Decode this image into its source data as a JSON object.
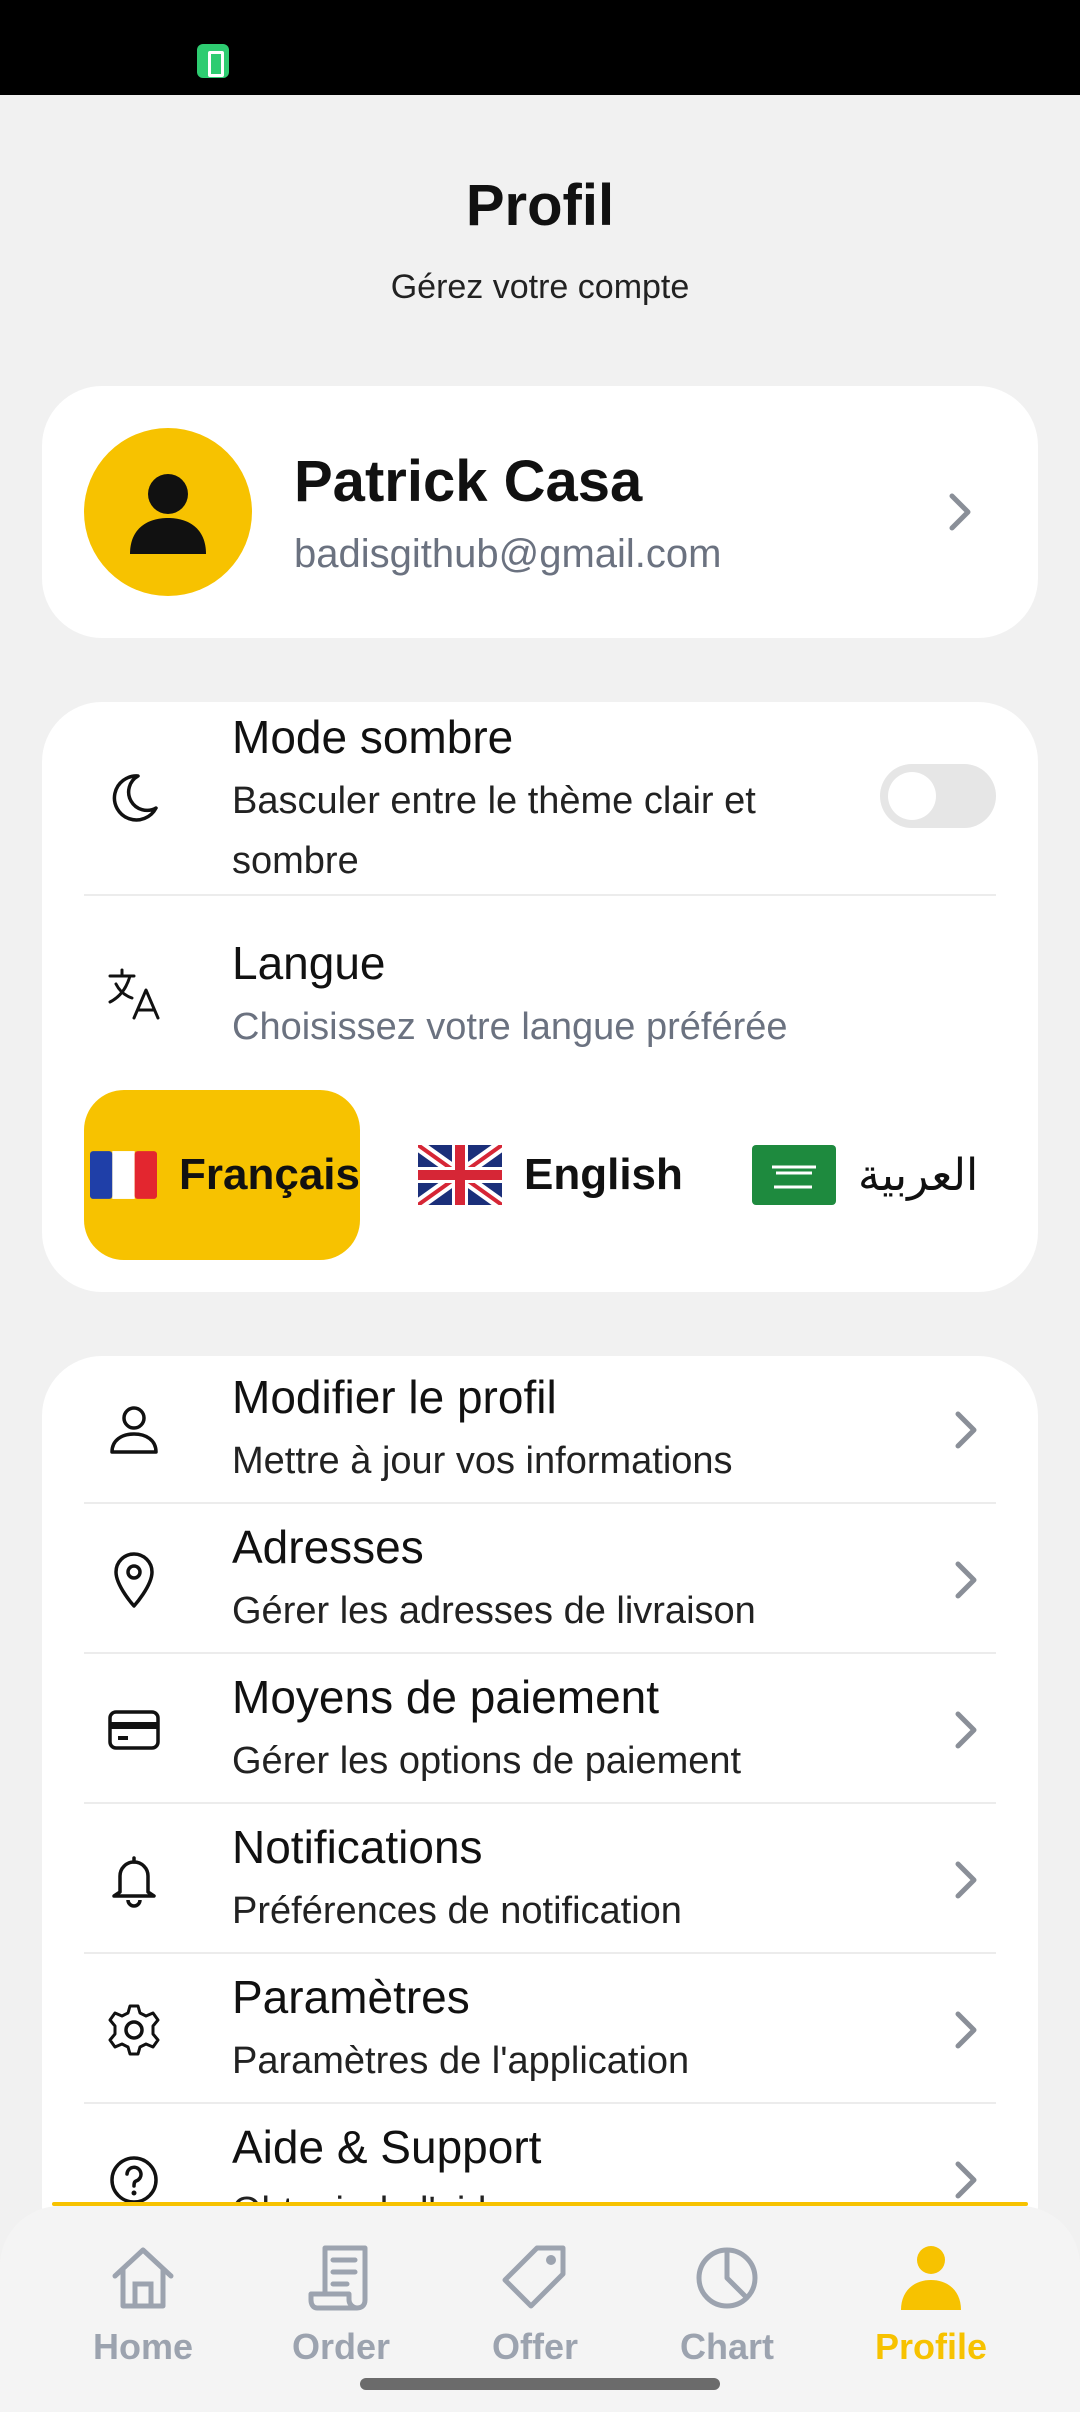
{
  "header": {
    "title": "Profil",
    "subtitle": "Gérez votre compte"
  },
  "profile": {
    "name": "Patrick Casa",
    "email": "badisgithub@gmail.com"
  },
  "settings": {
    "dark_mode": {
      "title": "Mode sombre",
      "subtitle_line1": "Basculer entre le thème clair et",
      "subtitle_line2": "sombre",
      "enabled": false
    },
    "language": {
      "title": "Langue",
      "subtitle": "Choisissez votre langue préférée"
    },
    "languages": [
      {
        "label": "Français",
        "active": true
      },
      {
        "label": "English",
        "active": false
      },
      {
        "label": "العربية",
        "active": false
      }
    ]
  },
  "menu": [
    {
      "title": "Modifier le profil",
      "subtitle": "Mettre à jour vos informations",
      "icon": "user-icon"
    },
    {
      "title": "Adresses",
      "subtitle": "Gérer les adresses de livraison",
      "icon": "map-pin-icon"
    },
    {
      "title": "Moyens de paiement",
      "subtitle": "Gérer les options de paiement",
      "icon": "credit-card-icon"
    },
    {
      "title": "Notifications",
      "subtitle": "Préférences de notification",
      "icon": "bell-icon"
    },
    {
      "title": "Paramètres",
      "subtitle": "Paramètres de l'application",
      "icon": "gear-icon"
    },
    {
      "title": "Aide & Support",
      "subtitle": "Obtenir de l'aide",
      "icon": "help-circle-icon"
    }
  ],
  "nav": [
    {
      "label": "Home",
      "icon": "home-icon"
    },
    {
      "label": "Order",
      "icon": "receipt-icon"
    },
    {
      "label": "Offer",
      "icon": "tag-icon"
    },
    {
      "label": "Chart",
      "icon": "pie-chart-icon"
    },
    {
      "label": "Profile",
      "icon": "profile-icon",
      "active": true
    }
  ],
  "colors": {
    "accent": "#f7c200",
    "background": "#f1f1f1",
    "muted": "#6b7280",
    "nav_inactive": "#9ca3af"
  }
}
